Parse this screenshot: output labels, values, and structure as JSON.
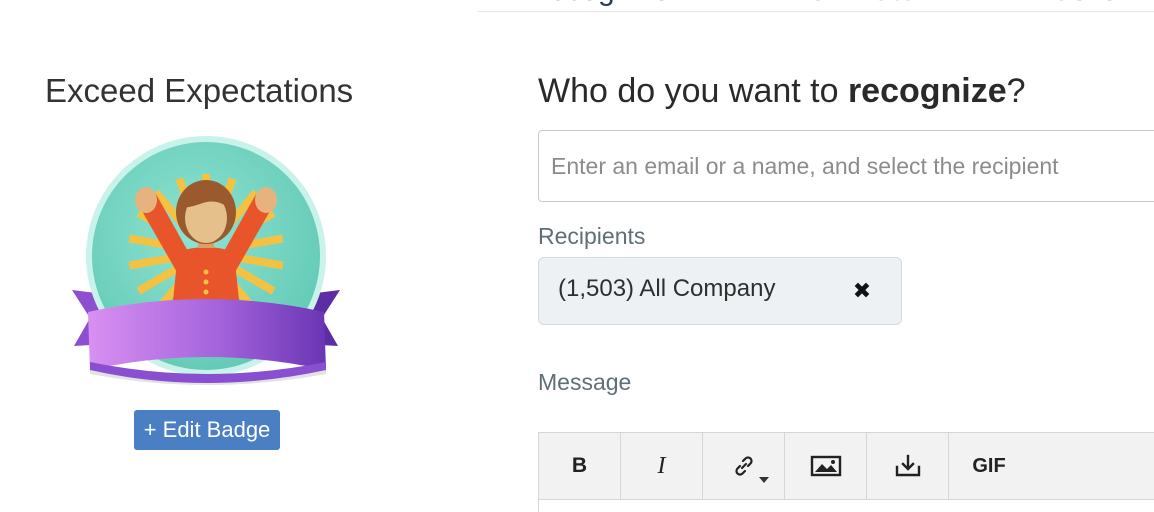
{
  "tabs": [
    {
      "label": "Recognize"
    },
    {
      "label": "Nominate"
    },
    {
      "label": "Tasks"
    }
  ],
  "badge": {
    "title": "Exceed Expectations",
    "edit_label": "+ Edit Badge"
  },
  "form": {
    "heading_prefix": "Who do you want to ",
    "heading_bold": "recognize",
    "heading_suffix": "?",
    "recipient_placeholder": "Enter an email or a name, and select the recipient",
    "recipients_label": "Recipients",
    "recipients": [
      {
        "label": "(1,503) All Company",
        "remove_glyph": "✖"
      }
    ],
    "message_label": "Message"
  },
  "toolbar": {
    "bold_label": "B",
    "italic_label": "I",
    "gif_label": "GIF",
    "link_icon": "link-icon",
    "image_icon": "image-icon",
    "download_icon": "download-icon"
  },
  "colors": {
    "primary": "#4a7fc4",
    "tab_link": "#3b7bc8",
    "badge_teal": "#6fd3c0",
    "ribbon_purple": "#9b5bd6",
    "person_orange": "#e8552b"
  }
}
